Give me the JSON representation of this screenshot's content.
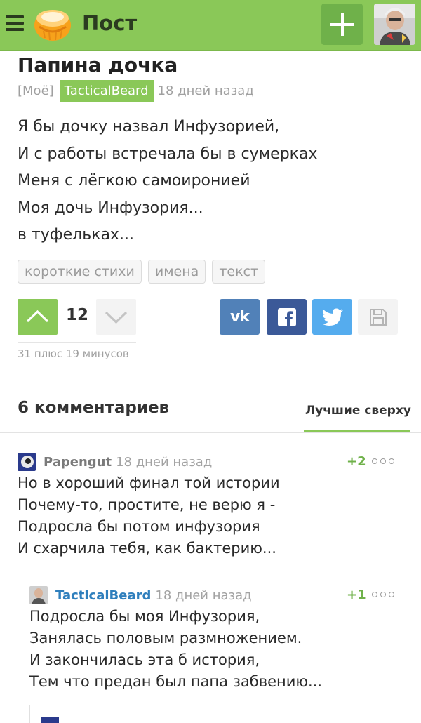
{
  "header": {
    "title": "Пост",
    "menu_icon": "hamburger-menu-icon",
    "logo_icon": "cupcake-logo-icon",
    "add_icon": "plus-icon",
    "accent_color": "#8ac858"
  },
  "post": {
    "title": "Папина дочка",
    "tag_moe": "[Моё]",
    "author": "TacticalBeard",
    "date": "18 дней назад",
    "body": [
      "Я бы дочку назвал Инфузорией,",
      "И с работы встречала бы в сумерках",
      "Меня с лёгкою самоиронией",
      "Моя дочь Инфузория...",
      "в туфельках..."
    ],
    "tags": [
      "короткие стихи",
      "имена",
      "текст"
    ],
    "rating": "12",
    "vote_stats": "31 плюс 19 минусов",
    "share": {
      "vk_label": "vk"
    }
  },
  "comments": {
    "title": "6 комментариев",
    "sort_label": "Лучшие сверху",
    "items": [
      {
        "author": "Papengut",
        "date": "18 дней назад",
        "rating": "+2",
        "author_color": "#7a7a7a",
        "body": [
          "Но в хороший финал той истории",
          "Почему-то, простите, не верю я -",
          "Подросла бы потом инфузория",
          "И схарчила тебя, как бактерию..."
        ]
      },
      {
        "author": "TacticalBeard",
        "date": "18 дней назад",
        "rating": "+1",
        "author_color": "#2f7fbd",
        "body": [
          "Подросла бы моя Инфузория,",
          "Занялась половым размножением.",
          "И закончилась эта б история,",
          "Тем что предан был папа забвению..."
        ]
      }
    ]
  }
}
